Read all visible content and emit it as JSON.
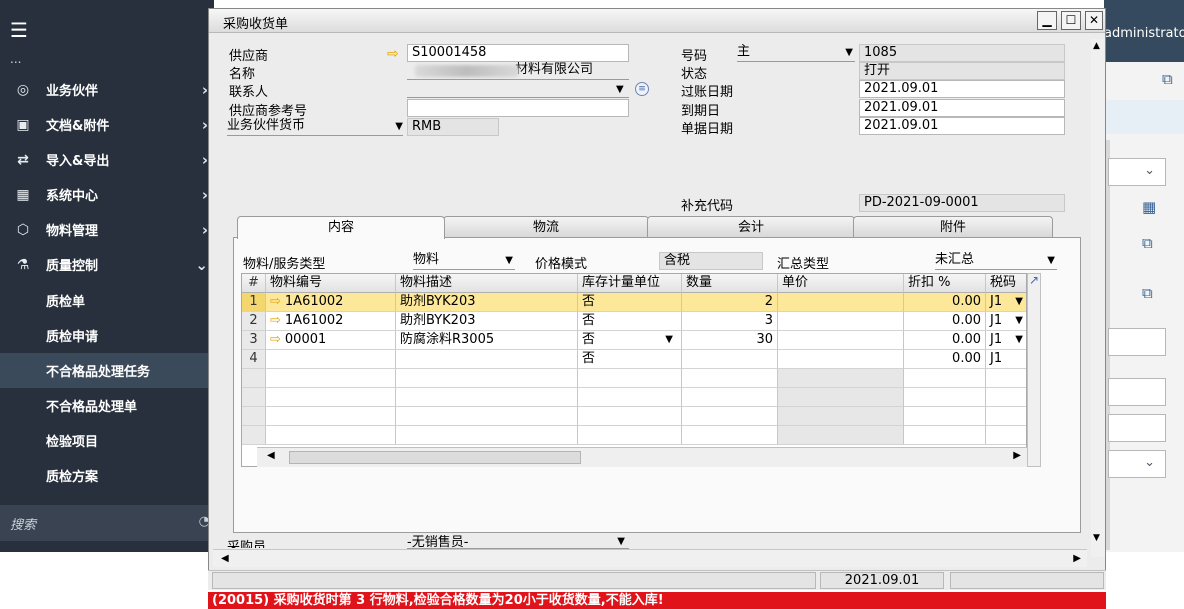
{
  "sidebar": {
    "partial_item": "...",
    "items": [
      {
        "label": "业务伙伴",
        "icon": "contact-icon"
      },
      {
        "label": "文档&附件",
        "icon": "document-icon"
      },
      {
        "label": "导入&导出",
        "icon": "import-export-icon"
      },
      {
        "label": "系统中心",
        "icon": "system-icon"
      },
      {
        "label": "物料管理",
        "icon": "material-icon"
      },
      {
        "label": "质量控制",
        "icon": "quality-icon"
      }
    ],
    "sub_items": [
      "质检单",
      "质检申请",
      "不合格品处理任务",
      "不合格品处理单",
      "检验项目",
      "质检方案"
    ],
    "active_sub": "不合格品处理任务",
    "search_placeholder": "搜索"
  },
  "right_panel": {
    "user": "administrator"
  },
  "window": {
    "title": "采购收货单",
    "header": {
      "vendor_label": "供应商",
      "vendor_value": "S10001458",
      "name_label": "名称",
      "name_value": "材料有限公司",
      "contact_label": "联系人",
      "contact_value": "",
      "vendor_ref_label": "供应商参考号",
      "vendor_ref_value": "",
      "currency_label": "业务伙伴货币",
      "currency_value": "RMB",
      "number_label": "号码",
      "series_value": "主",
      "number_value": "1085",
      "status_label": "状态",
      "status_value": "打开",
      "posting_date_label": "过账日期",
      "posting_date_value": "2021.09.01",
      "due_date_label": "到期日",
      "due_date_value": "2021.09.01",
      "doc_date_label": "单据日期",
      "doc_date_value": "2021.09.01",
      "supp_code_label": "补充代码",
      "supp_code_value": "PD-2021-09-0001"
    },
    "tabs": [
      "内容",
      "物流",
      "会计",
      "附件"
    ],
    "content": {
      "item_type_label": "物料/服务类型",
      "item_type_value": "物料",
      "price_mode_label": "价格模式",
      "price_mode_value": "含税",
      "summary_type_label": "汇总类型",
      "summary_type_value": "未汇总"
    },
    "grid": {
      "columns": [
        "#",
        "物料编号",
        "物料描述",
        "库存计量单位",
        "数量",
        "单价",
        "折扣 %",
        "税码"
      ],
      "rows": [
        {
          "num": "1",
          "code": "1A61002",
          "desc": "助剂BYK203",
          "uom": "否",
          "qty": "2",
          "price": "",
          "discount": "0.00",
          "tax": "J1"
        },
        {
          "num": "2",
          "code": "1A61002",
          "desc": "助剂BYK203",
          "uom": "否",
          "qty": "3",
          "price": "",
          "discount": "0.00",
          "tax": "J1"
        },
        {
          "num": "3",
          "code": "00001",
          "desc": "防腐涂料R3005",
          "uom": "否",
          "qty": "30",
          "price": "",
          "discount": "0.00",
          "tax": "J1"
        },
        {
          "num": "4",
          "code": "",
          "desc": "",
          "uom": "否",
          "qty": "",
          "price": "",
          "discount": "0.00",
          "tax": "J1"
        }
      ]
    },
    "footer": {
      "buyer_label": "采购员",
      "buyer_value": "-无销售员-"
    }
  },
  "statusbar": {
    "date": "2021.09.01"
  },
  "error_message": "(20015) 采购收货时第 3 行物料,检验合格数量为20小于收货数量,不能入库!",
  "colors": {
    "sidebar": "#27303c",
    "selected_row": "#fde89a",
    "error": "#e0131a",
    "link_arrow": "#e3a200"
  }
}
